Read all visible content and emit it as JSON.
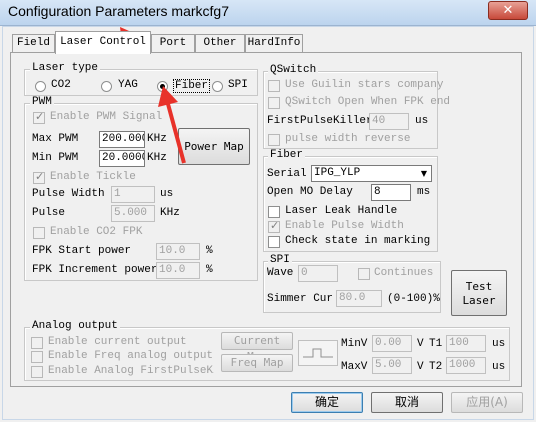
{
  "window": {
    "title": "Configuration Parameters markcfg7",
    "close": "✕"
  },
  "tabs": [
    {
      "label": "Field"
    },
    {
      "label": "Laser Control"
    },
    {
      "label": "Port"
    },
    {
      "label": "Other"
    },
    {
      "label": "HardInfo"
    }
  ],
  "laser_type": {
    "legend": "Laser type",
    "options": [
      "CO2",
      "YAG",
      "Fiber",
      "SPI"
    ],
    "selected": "Fiber"
  },
  "pwm": {
    "legend": "PWM",
    "enable_signal": "Enable PWM Signal",
    "max_label": "Max PWM",
    "max_value": "200.000",
    "max_unit": "KHz",
    "min_label": "Min PWM",
    "min_value": "20.0000",
    "min_unit": "KHz",
    "power_map": "Power Map",
    "enable_tickle": "Enable Tickle",
    "pulse_width_label": "Pulse Width",
    "pulse_width_value": "1",
    "pulse_width_unit": "us",
    "pulse_label": "Pulse",
    "pulse_value": "5.000",
    "pulse_unit": "KHz",
    "enable_co2_fpk": "Enable CO2 FPK",
    "fpk_start_label": "FPK Start power",
    "fpk_start_value": "10.0",
    "fpk_start_unit": "%",
    "fpk_inc_label": "FPK Increment power",
    "fpk_inc_value": "10.0",
    "fpk_inc_unit": "%"
  },
  "qswitch": {
    "legend": "QSwitch",
    "use_guilin": "Use Guilin stars company",
    "open_fpk": "QSwitch Open When FPK end",
    "first_pulse_label": "FirstPulseKiller",
    "first_pulse_value": "40",
    "first_pulse_unit": "us",
    "pulse_reverse": "pulse width reverse"
  },
  "fiber": {
    "legend": "Fiber",
    "serial_label": "Serial",
    "serial_value": "IPG_YLP",
    "open_mo_label": "Open MO Delay",
    "open_mo_value": "8",
    "open_mo_unit": "ms",
    "leak_handle": "Laser Leak Handle",
    "enable_pulse_width": "Enable Pulse Width",
    "check_state": "Check state in marking"
  },
  "spi": {
    "legend": "SPI",
    "wave_label": "Wave",
    "wave_value": "0",
    "continues": "Continues",
    "simmer_label": "Simmer Cur",
    "simmer_value": "80.0",
    "simmer_unit": "(0-100)%"
  },
  "test_laser": {
    "line1": "Test",
    "line2": "Laser"
  },
  "analog": {
    "legend": "Analog output",
    "enable_current": "Enable current output",
    "enable_freq": "Enable Freq analog output",
    "enable_first_pulse": "Enable Analog FirstPulseKill",
    "current_map": "Current Map",
    "freq_map": "Freq Map",
    "minv_label": "MinV",
    "minv_value": "0.00",
    "v1_unit": "V",
    "t1_label": "T1",
    "t1_value": "100",
    "t1_unit": "us",
    "maxv_label": "MaxV",
    "maxv_value": "5.00",
    "v2_unit": "V",
    "t2_label": "T2",
    "t2_value": "1000",
    "t2_unit": "us"
  },
  "footer": {
    "ok": "确定",
    "cancel": "取消",
    "apply": "应用(A)"
  },
  "colors": {
    "arrow": "#e8322a"
  }
}
